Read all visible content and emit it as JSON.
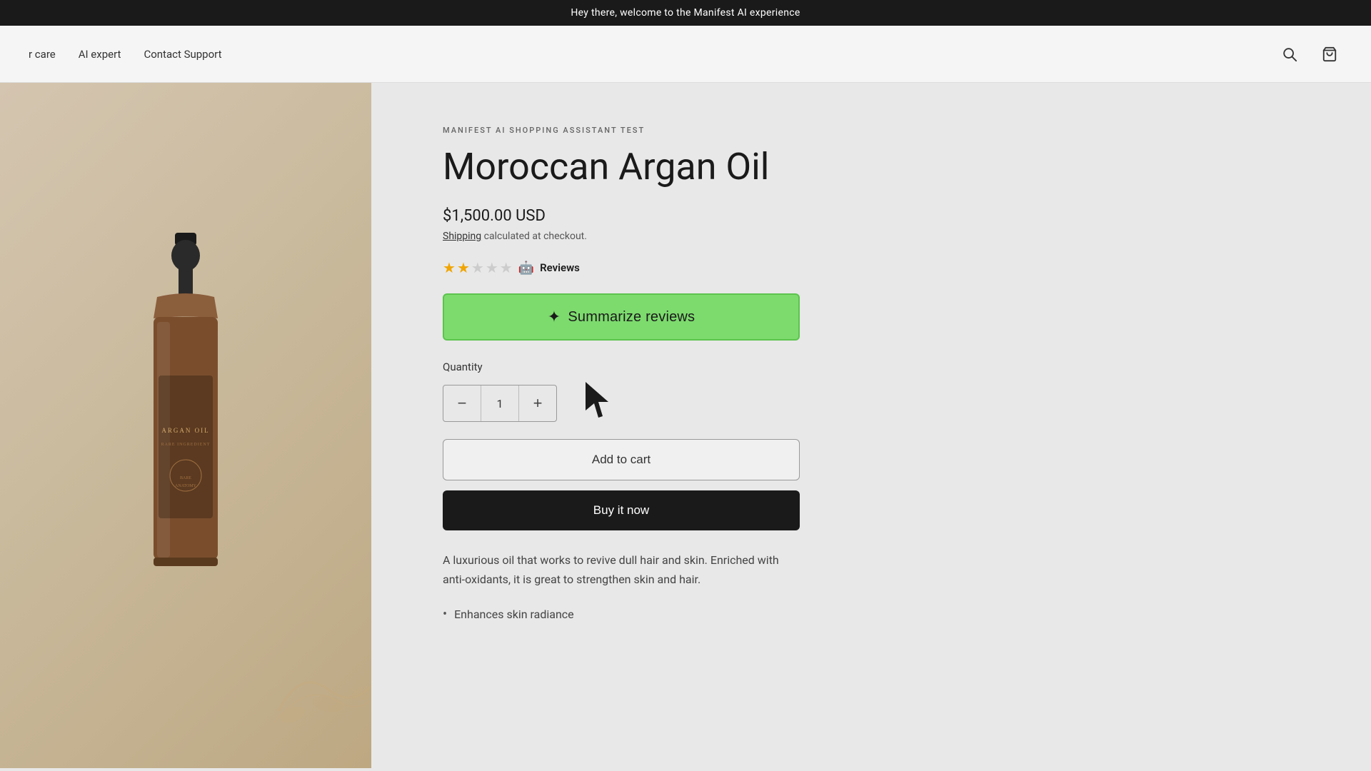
{
  "announcement": {
    "text": "Hey there, welcome to the Manifest AI experience"
  },
  "header": {
    "nav_items": [
      {
        "label": "r care",
        "href": "#"
      },
      {
        "label": "AI expert",
        "href": "#"
      },
      {
        "label": "Contact Support",
        "href": "#"
      }
    ],
    "icons": {
      "search": "🔍",
      "cart": "🛒"
    }
  },
  "product": {
    "brand": "MANIFEST AI SHOPPING ASSISTANT TEST",
    "title": "Moroccan Argan Oil",
    "price": "$1,500.00 USD",
    "shipping_text": "calculated at checkout.",
    "shipping_link_label": "Shipping",
    "stars": {
      "filled": 2,
      "empty": 3,
      "total": 5
    },
    "reviews_label": "Reviews",
    "summarize_btn_label": "Summarize reviews",
    "quantity_label": "Quantity",
    "quantity_value": "1",
    "qty_decrease": "−",
    "qty_increase": "+",
    "add_to_cart_label": "Add to cart",
    "buy_now_label": "Buy it now",
    "description": "A luxurious oil that works to revive dull hair and skin. Enriched with anti-oxidants, it is great to strengthen skin and hair.",
    "features": [
      "Enhances skin radiance"
    ]
  }
}
